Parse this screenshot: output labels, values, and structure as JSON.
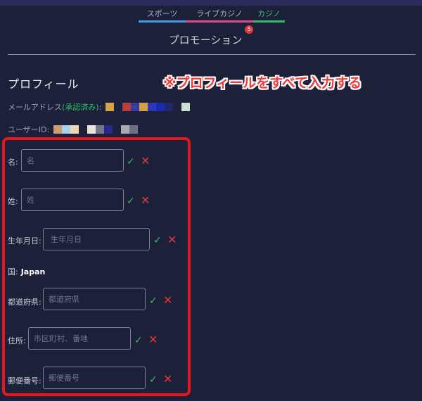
{
  "tabs": [
    {
      "label": "スポーツ"
    },
    {
      "label": "ライブカジノ"
    },
    {
      "label": "カジノ"
    }
  ],
  "page": {
    "title": "プロモーション",
    "notification_count": "5"
  },
  "profile": {
    "section_title": "プロフィール",
    "overlay_note": "※プロフィールをすべて入力する",
    "email_label": "メールアドレス",
    "email_status": "(承認済み)",
    "email_suffix": ":",
    "userid_label": "ユーザーID:"
  },
  "fields": {
    "first_name": {
      "label": "名:",
      "placeholder": "名"
    },
    "last_name": {
      "label": "姓:",
      "placeholder": "姓"
    },
    "birthdate": {
      "label": "生年月日:",
      "placeholder": "生年月日"
    },
    "country": {
      "label": "国:",
      "value": "Japan"
    },
    "prefecture": {
      "label": "都道府県:",
      "placeholder": "都道府県"
    },
    "address": {
      "label": "住所:",
      "placeholder": "市区町村、番地"
    },
    "postal_code": {
      "label": "郵便番号:",
      "placeholder": "郵便番号"
    }
  },
  "icons": {
    "confirm": "✓",
    "cancel": "✕"
  },
  "colors": {
    "background": "#1c2039",
    "accent_green": "#2ec26b",
    "accent_red": "#e0383e",
    "highlight_box": "#e8161c"
  }
}
